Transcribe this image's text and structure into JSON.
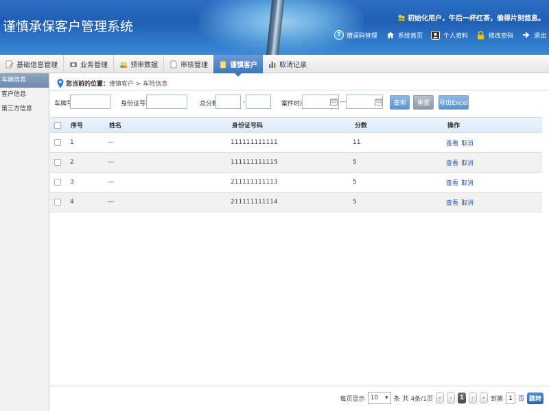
{
  "app": {
    "title": "谨慎承保客户管理系统",
    "greeting": "初始化用户，午后一杯红茶，偷得片刻悠息。"
  },
  "toplinks": [
    {
      "label": "错误码管理",
      "icon": "help-icon"
    },
    {
      "label": "系统首页",
      "icon": "home-icon"
    },
    {
      "label": "个人资料",
      "icon": "user-profile-icon"
    },
    {
      "label": "修改密码",
      "icon": "lock-icon"
    },
    {
      "label": "退出",
      "icon": "logout-arrow-icon"
    }
  ],
  "nav": [
    {
      "label": "基础信息管理",
      "icon": "edit-icon",
      "active": false
    },
    {
      "label": "业务管理",
      "icon": "business-icon",
      "active": false
    },
    {
      "label": "预审数据",
      "icon": "users-icon",
      "active": false
    },
    {
      "label": "审核管理",
      "icon": "document-icon",
      "active": false
    },
    {
      "label": "谨慎客户",
      "icon": "clipboard-icon",
      "active": true
    },
    {
      "label": "取消记录",
      "icon": "bar-chart-icon",
      "active": false
    }
  ],
  "sidebar": {
    "items": [
      {
        "label": "车辆信息",
        "active": true
      },
      {
        "label": "客户信息",
        "active": false
      },
      {
        "label": "第三方信息",
        "active": false
      }
    ]
  },
  "breadcrumb": {
    "lead": "您当前的位置：",
    "path": "谨慎客户 > 车险信息"
  },
  "filters": {
    "plate_label": "车牌号",
    "plate_value": "",
    "id_label": "身份证号码",
    "id_value": "",
    "score_label": "总分数",
    "score_min": "",
    "score_sep": "-",
    "score_max": "",
    "time_label": "案件时间",
    "time_start": "",
    "time_sep": "—",
    "time_end": "",
    "query_button": "查询",
    "reset_button": "重置",
    "export_button": "导出Excel"
  },
  "table": {
    "headers": {
      "seq": "序号",
      "name": "姓名",
      "id_number": "身份证号码",
      "score": "分数",
      "ops": "操作"
    },
    "rows": [
      {
        "seq": "1",
        "name": "—",
        "id_number": "111111111111",
        "score": "11",
        "view": "查看",
        "cancel": "取消"
      },
      {
        "seq": "2",
        "name": "—",
        "id_number": "111111111115",
        "score": "5",
        "view": "查看",
        "cancel": "取消"
      },
      {
        "seq": "3",
        "name": "—",
        "id_number": "211111111113",
        "score": "5",
        "view": "查看",
        "cancel": "取消"
      },
      {
        "seq": "4",
        "name": "—",
        "id_number": "211111111114",
        "score": "5",
        "view": "查看",
        "cancel": "取消"
      }
    ]
  },
  "pager": {
    "per_page_label": "每页显示",
    "per_page_value": "10",
    "unit": "条",
    "summary": "共 4条/1页",
    "current_page": "1",
    "goto_label": "到第",
    "goto_value": "1",
    "page_unit": "页",
    "go_button": "跳转"
  },
  "colors": {
    "header_blue": "#1f5fb5",
    "active_tab": "#3f76bd",
    "link_blue": "#2a5db0"
  }
}
